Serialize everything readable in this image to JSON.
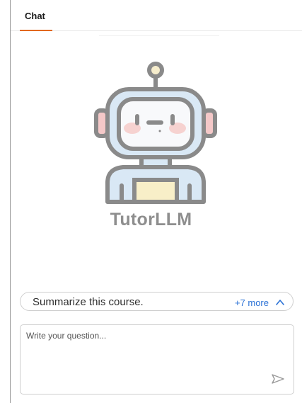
{
  "tabs": [
    {
      "label": "Chat",
      "active": true
    }
  ],
  "brand": {
    "name": "TutorLLM",
    "logo_icon": "robot-icon"
  },
  "suggestion": {
    "text": "Summarize this course.",
    "more_label": "+7 more",
    "caret_icon": "chevron-up-icon"
  },
  "question_input": {
    "placeholder": "Write your question...",
    "value": ""
  },
  "send_icon": "send-icon",
  "colors": {
    "accent": "#e2681f",
    "link": "#2b72d6",
    "brand_text": "#8e8e8e"
  }
}
